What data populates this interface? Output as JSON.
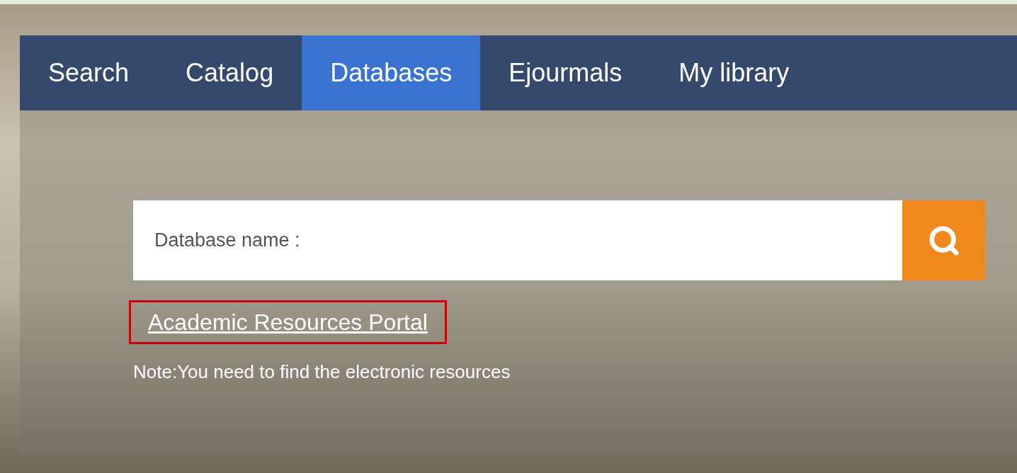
{
  "nav": {
    "tabs": [
      {
        "label": "Search",
        "selected": false
      },
      {
        "label": "Catalog",
        "selected": false
      },
      {
        "label": "Databases",
        "selected": true
      },
      {
        "label": "Ejourmals",
        "selected": false
      },
      {
        "label": "My library",
        "selected": false
      }
    ]
  },
  "search": {
    "placeholder": "Database name :"
  },
  "link": {
    "label": "Academic Resources Portal",
    "highlighted": true
  },
  "note": "Note:You need to find the electronic resources"
}
